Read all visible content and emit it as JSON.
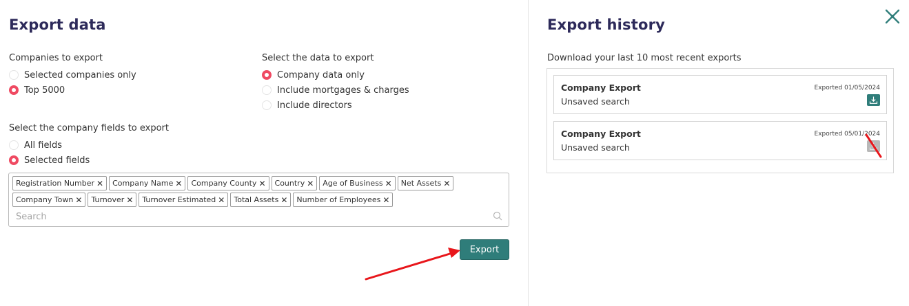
{
  "export_data": {
    "title": "Export data",
    "companies_to_export": {
      "label": "Companies to export",
      "options": [
        {
          "label": "Selected companies only",
          "checked": false
        },
        {
          "label": "Top 5000",
          "checked": true
        }
      ]
    },
    "data_to_export": {
      "label": "Select the data to export",
      "options": [
        {
          "label": "Company data only",
          "checked": true
        },
        {
          "label": "Include mortgages & charges",
          "checked": false
        },
        {
          "label": "Include directors",
          "checked": false
        }
      ]
    },
    "company_fields": {
      "label": "Select the company fields to export",
      "options": [
        {
          "label": "All fields",
          "checked": false
        },
        {
          "label": "Selected fields",
          "checked": true
        }
      ]
    },
    "selected_fields": [
      "Registration Number",
      "Company Name",
      "Company County",
      "Country",
      "Age of Business",
      "Net Assets",
      "Company Town",
      "Turnover",
      "Turnover Estimated",
      "Total Assets",
      "Number of Employees"
    ],
    "search_placeholder": "Search",
    "export_button": "Export"
  },
  "export_history": {
    "title": "Export history",
    "subtitle": "Download your last 10 most recent exports",
    "items": [
      {
        "title": "Company Export",
        "subtitle": "Unsaved search",
        "date": "Exported 01/05/2024",
        "download_state": "active"
      },
      {
        "title": "Company Export",
        "subtitle": "Unsaved search",
        "date": "Exported 05/01/2024",
        "download_state": "disabled"
      }
    ]
  },
  "icons": {
    "close": "close-icon",
    "search": "search-icon",
    "download": "download-icon",
    "chip_remove": "remove-x-icon"
  },
  "colors": {
    "title": "#2d2a5a",
    "accent": "#2f7d7a",
    "radio_checked": "#ef4a62",
    "annotation_arrow": "#e8161b"
  }
}
